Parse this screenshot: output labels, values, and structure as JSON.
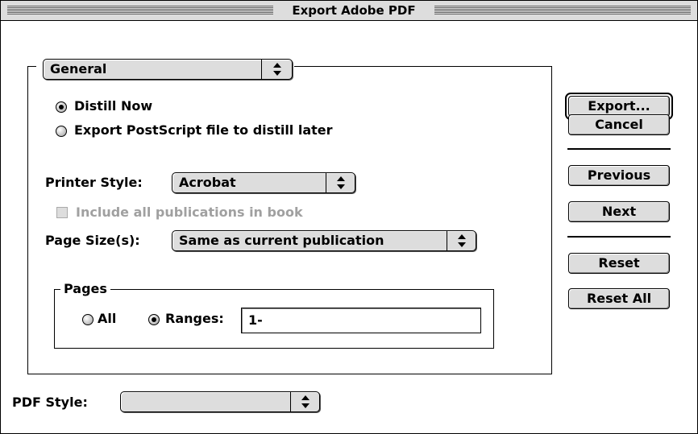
{
  "window": {
    "title": "Export Adobe PDF"
  },
  "section_popup": {
    "value": "General"
  },
  "export_mode": {
    "distill_now": "Distill Now",
    "export_postscript": "Export PostScript file to distill later",
    "selected": "Distill Now"
  },
  "printer_style": {
    "label": "Printer Style:",
    "value": "Acrobat"
  },
  "include_publications": {
    "label": "Include all publications in book",
    "checked": false,
    "enabled": false
  },
  "page_size": {
    "label": "Page Size(s):",
    "value": "Same as current publication"
  },
  "pages": {
    "group_label": "Pages",
    "all_label": "All",
    "ranges_label": "Ranges:",
    "ranges_value": "1-",
    "selected": "Ranges"
  },
  "pdf_style": {
    "label": "PDF Style:",
    "value": ""
  },
  "buttons": {
    "export": "Export...",
    "cancel": "Cancel",
    "previous": "Previous",
    "next": "Next",
    "reset": "Reset",
    "reset_all": "Reset All"
  },
  "icons": {
    "popup_arrow": "up-down-arrows-icon",
    "radio": "radio-button-icon",
    "checkbox": "checkbox-icon"
  }
}
